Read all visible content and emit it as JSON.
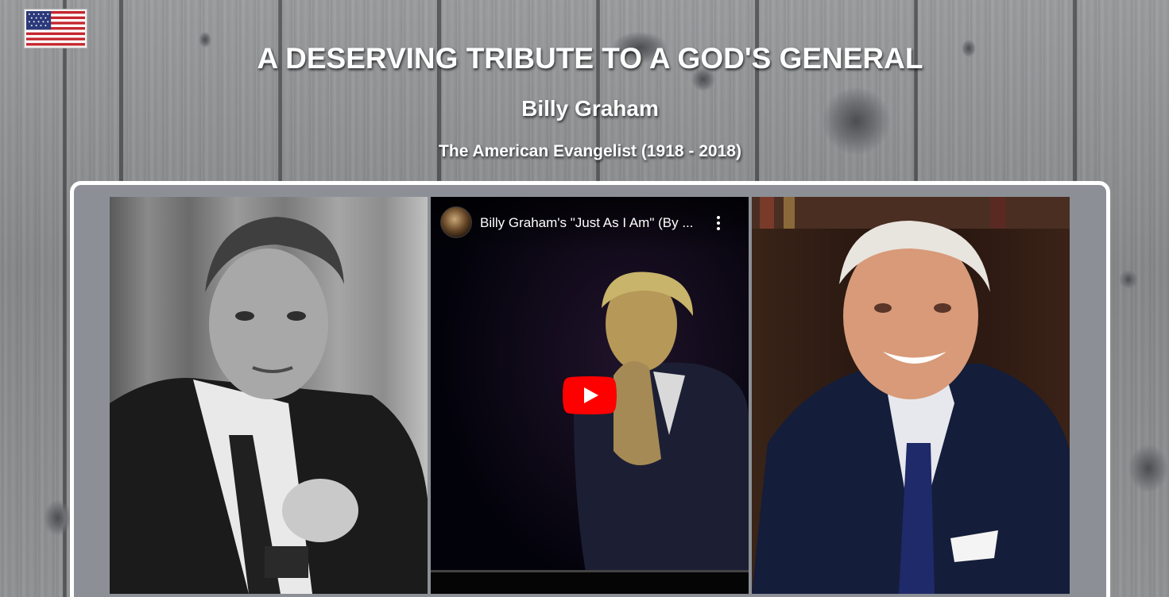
{
  "header": {
    "title": "A DESERVING TRIBUTE TO A GOD'S GENERAL",
    "subtitle": "Billy Graham",
    "tagline": "The American Evangelist (1918 - 2018)"
  },
  "flag_icon": "us-flag-icon",
  "gallery": {
    "left_photo": "billy-graham-bw-portrait",
    "right_photo": "billy-graham-color-portrait",
    "video": {
      "title": "Billy Graham's \"Just As I Am\" (By ...",
      "channel_icon": "channel-avatar",
      "menu_icon": "more-vert-icon",
      "play_icon": "youtube-play-icon"
    }
  },
  "colors": {
    "panel_bg": "#8c9096",
    "panel_border": "#ffffff",
    "play_red": "#ff0000",
    "heading_text": "#ffffff"
  }
}
